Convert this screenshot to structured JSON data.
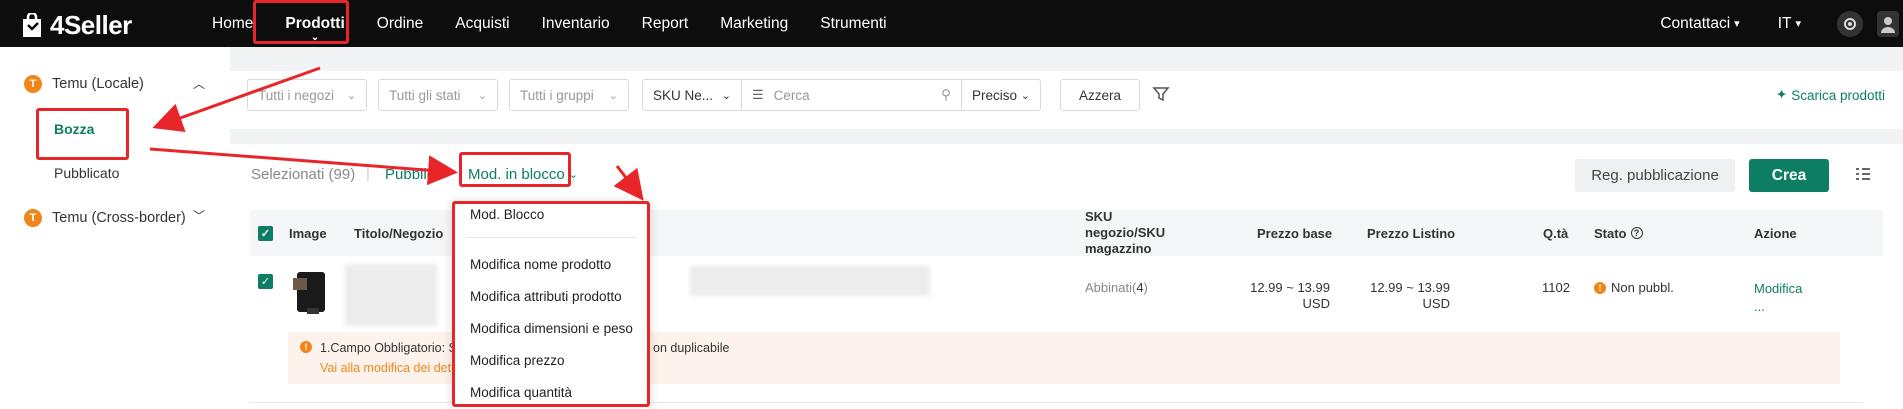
{
  "brand": {
    "name": "4Seller"
  },
  "nav": {
    "items": [
      "Home",
      "Prodotti",
      "Ordine",
      "Acquisti",
      "Inventario",
      "Report",
      "Marketing",
      "Strumenti"
    ],
    "active": "Prodotti"
  },
  "topbar": {
    "contact": "Contattaci",
    "lang": "IT"
  },
  "sidebar": {
    "group1": "Temu (Locale)",
    "group1_badge": "T",
    "sub1": "Bozza",
    "sub2": "Pubblicato",
    "group2": "Temu (Cross-border)",
    "group2_badge": "T"
  },
  "filters": {
    "shops": "Tutti i negozi",
    "states": "Tutti gli stati",
    "groups": "Tutti i gruppi",
    "sku": "SKU Ne...",
    "search_placeholder": "Cerca",
    "precision": "Preciso",
    "reset": "Azzera",
    "download": "Scarica prodotti"
  },
  "actions": {
    "selected": "Selezionati (99)",
    "publish": "Pubblica",
    "bulk_edit": "Mod. in blocco",
    "reg_publish": "Reg. pubblicazione",
    "create": "Crea"
  },
  "table": {
    "headers": {
      "image": "Image",
      "title": "Titolo/Negozio",
      "sku": "SKU negozio/SKU magazzino",
      "base_price": "Prezzo base",
      "list_price": "Prezzo Listino",
      "qty": "Q.tà",
      "status": "Stato",
      "action": "Azione"
    },
    "row": {
      "sku_matched": "Abbinati(",
      "sku_count": "4",
      "sku_close": ")",
      "base_price": "12.99 ~ 13.99",
      "base_currency": "USD",
      "list_price": "12.99 ~ 13.99",
      "list_currency": "USD",
      "qty": "1102",
      "status": "Non pubbl.",
      "action_edit": "Modifica",
      "action_more": "..."
    },
    "warning": {
      "text": "1.Campo Obbligatorio: S",
      "text_tail": "on duplicabile",
      "link": "Vai alla modifica dei det"
    }
  },
  "dropdown": {
    "items": [
      "Mod. Blocco",
      "Modifica nome prodotto",
      "Modifica attributi prodotto",
      "Modifica dimensioni e peso",
      "Modifica prezzo",
      "Modifica quantità"
    ]
  },
  "colors": {
    "accent": "#0d7d64",
    "annotation": "#e8262a",
    "badge": "#f08519"
  }
}
